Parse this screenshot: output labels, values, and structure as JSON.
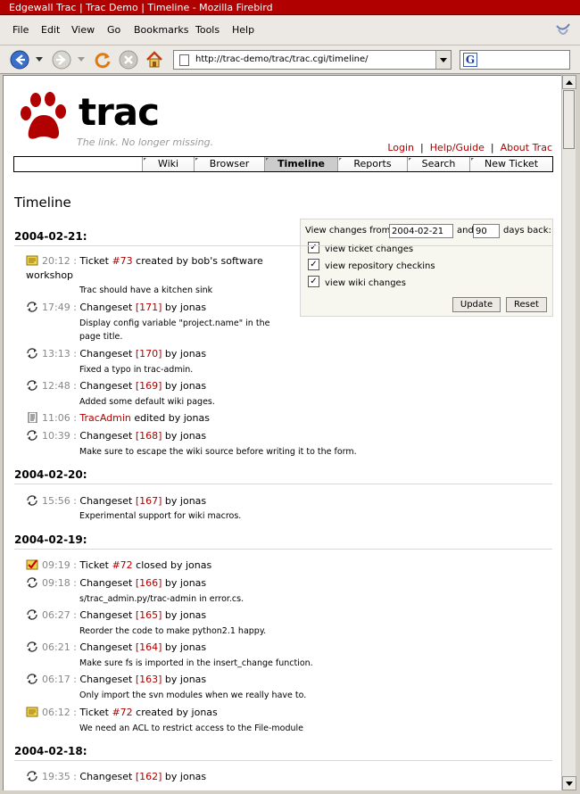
{
  "window": {
    "title": "Edgewall Trac | Trac Demo | Timeline - Mozilla Firebird"
  },
  "menu": [
    "File",
    "Edit",
    "View",
    "Go",
    "Bookmarks",
    "Tools",
    "Help"
  ],
  "address": {
    "url": "http://trac-demo/trac/trac.cgi/timeline/"
  },
  "search": {
    "engine_icon": "G"
  },
  "trac": {
    "logo_text": "trac",
    "tagline": "The link. No longer missing.",
    "metanav": [
      "Login",
      "Help/Guide",
      "About Trac"
    ],
    "mainnav": [
      "Wiki",
      "Browser",
      "Timeline",
      "Reports",
      "Search",
      "New Ticket"
    ],
    "active_tab": "Timeline",
    "heading": "Timeline"
  },
  "prefs": {
    "from_label": "View changes from",
    "from_value": "2004-02-21",
    "and_label": "and",
    "days_value": "90",
    "days_label": "days back:",
    "checkboxes": [
      {
        "label": "view ticket changes",
        "checked": true
      },
      {
        "label": "view repository checkins",
        "checked": true
      },
      {
        "label": "view wiki changes",
        "checked": true
      }
    ],
    "update_label": "Update",
    "reset_label": "Reset"
  },
  "timeline": [
    {
      "date": "2004-02-21:",
      "events": [
        {
          "type": "ticket-new",
          "time": "20:12",
          "pre": "Ticket ",
          "link": "#73",
          "post": " created by bob's software",
          "post2": "workshop",
          "desc": "Trac should have a kitchen sink"
        },
        {
          "type": "changeset",
          "time": "17:49",
          "pre": "Changeset ",
          "link": "[171]",
          "post": " by jonas",
          "desc": "Display config variable \"project.name\" in the",
          "desc2": "page title."
        },
        {
          "type": "changeset",
          "time": "13:13",
          "pre": "Changeset ",
          "link": "[170]",
          "post": " by jonas",
          "desc": "Fixed a typo in trac-admin."
        },
        {
          "type": "changeset",
          "time": "12:48",
          "pre": "Changeset ",
          "link": "[169]",
          "post": " by jonas",
          "desc": "Added some default wiki pages."
        },
        {
          "type": "wiki",
          "time": "11:06",
          "pre": "",
          "link": "TracAdmin",
          "post": " edited by jonas"
        },
        {
          "type": "changeset",
          "time": "10:39",
          "pre": "Changeset ",
          "link": "[168]",
          "post": " by jonas",
          "desc": "Make sure to escape the wiki source before writing it to the form."
        }
      ]
    },
    {
      "date": "2004-02-20:",
      "events": [
        {
          "type": "changeset",
          "time": "15:56",
          "pre": "Changeset ",
          "link": "[167]",
          "post": " by jonas",
          "desc": "Experimental support for wiki macros."
        }
      ]
    },
    {
      "date": "2004-02-19:",
      "events": [
        {
          "type": "ticket-closed",
          "time": "09:19",
          "pre": "Ticket ",
          "link": "#72",
          "post": " closed by jonas"
        },
        {
          "type": "changeset",
          "time": "09:18",
          "pre": "Changeset ",
          "link": "[166]",
          "post": " by jonas",
          "desc": "s/trac_admin.py/trac-admin in error.cs."
        },
        {
          "type": "changeset",
          "time": "06:27",
          "pre": "Changeset ",
          "link": "[165]",
          "post": " by jonas",
          "desc": "Reorder the code to make python2.1 happy."
        },
        {
          "type": "changeset",
          "time": "06:21",
          "pre": "Changeset ",
          "link": "[164]",
          "post": " by jonas",
          "desc": "Make sure fs is imported in the insert_change function."
        },
        {
          "type": "changeset",
          "time": "06:17",
          "pre": "Changeset ",
          "link": "[163]",
          "post": " by jonas",
          "desc": "Only import the svn modules when we really have to."
        },
        {
          "type": "ticket-new",
          "time": "06:12",
          "pre": "Ticket ",
          "link": "#72",
          "post": " created by jonas",
          "desc": "We need an ACL to restrict access to the File-module"
        }
      ]
    },
    {
      "date": "2004-02-18:",
      "events": [
        {
          "type": "changeset",
          "time": "19:35",
          "pre": "Changeset ",
          "link": "[162]",
          "post": " by jonas"
        }
      ]
    }
  ]
}
